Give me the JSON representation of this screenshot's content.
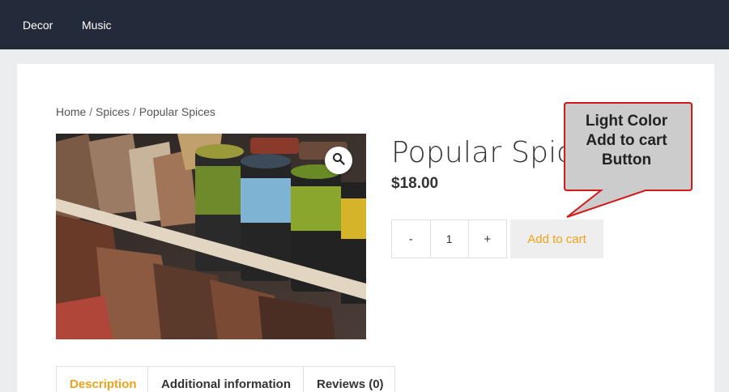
{
  "nav": {
    "items": [
      {
        "label": "Decor"
      },
      {
        "label": "Music"
      }
    ]
  },
  "breadcrumb": {
    "home": "Home",
    "category": "Spices",
    "current": "Popular Spices",
    "separator": " / "
  },
  "product": {
    "title": "Popular Spices",
    "price": "$18.00",
    "image_icon": "zoom-magnifier-icon",
    "quantity": "1",
    "decrement_label": "-",
    "increment_label": "+",
    "add_to_cart_label": "Add to cart"
  },
  "annotation": {
    "line1": "Light Color",
    "line2": "Add to cart",
    "line3": "Button"
  },
  "tabs": [
    {
      "label": "Description"
    },
    {
      "label": "Additional information"
    },
    {
      "label": "Reviews (0)"
    }
  ],
  "colors": {
    "header": "#232b3a",
    "accent": "#f0a21b",
    "callout_fill": "#cccccc",
    "callout_border": "#d11a1a"
  }
}
